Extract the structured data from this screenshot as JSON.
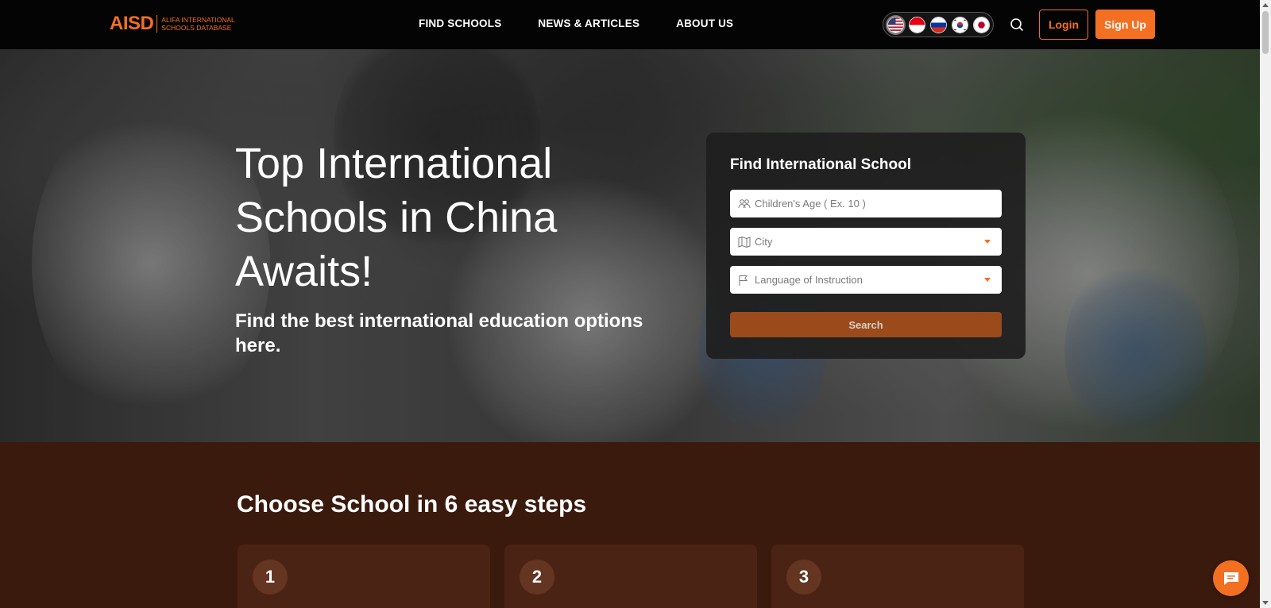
{
  "header": {
    "logo_mark": "AISD",
    "logo_sub_line1": "ALIFA INTERNATIONAL",
    "logo_sub_line2": "SCHOOLS DATABASE",
    "nav": [
      "FIND SCHOOLS",
      "NEWS & ARTICLES",
      "ABOUT US"
    ],
    "languages": [
      "us-flag-icon",
      "id-flag-icon",
      "ru-flag-icon",
      "kr-flag-icon",
      "jp-flag-icon"
    ],
    "login_label": "Login",
    "signup_label": "Sign Up"
  },
  "hero": {
    "title": "Top International Schools in China Awaits!",
    "subtitle": "Find the best international education options here."
  },
  "search_card": {
    "title": "Find International School",
    "age_placeholder": "Children's Age ( Ex. 10 )",
    "city_label": "City",
    "language_label": "Language of Instruction",
    "search_label": "Search"
  },
  "steps": {
    "title": "Choose School in 6 easy steps",
    "items": [
      "1",
      "2",
      "3"
    ]
  },
  "colors": {
    "accent": "#f36f21",
    "header_bg": "#040404",
    "section_bg": "#3b1a0e",
    "search_button": "#9b4a1c"
  }
}
